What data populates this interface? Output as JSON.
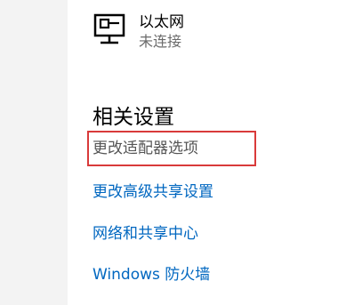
{
  "network": {
    "name": "以太网",
    "status": "未连接"
  },
  "related_settings": {
    "title": "相关设置",
    "links": [
      {
        "label": "更改适配器选项",
        "style": "gray",
        "highlighted": true
      },
      {
        "label": "更改高级共享设置",
        "style": "blue"
      },
      {
        "label": "网络和共享中心",
        "style": "blue"
      },
      {
        "label": "Windows 防火墙",
        "style": "blue"
      }
    ]
  },
  "colors": {
    "link": "#0067c0",
    "highlight": "#d93a3a",
    "muted": "#555555"
  },
  "icons": {
    "network": "ethernet-monitor-icon"
  }
}
